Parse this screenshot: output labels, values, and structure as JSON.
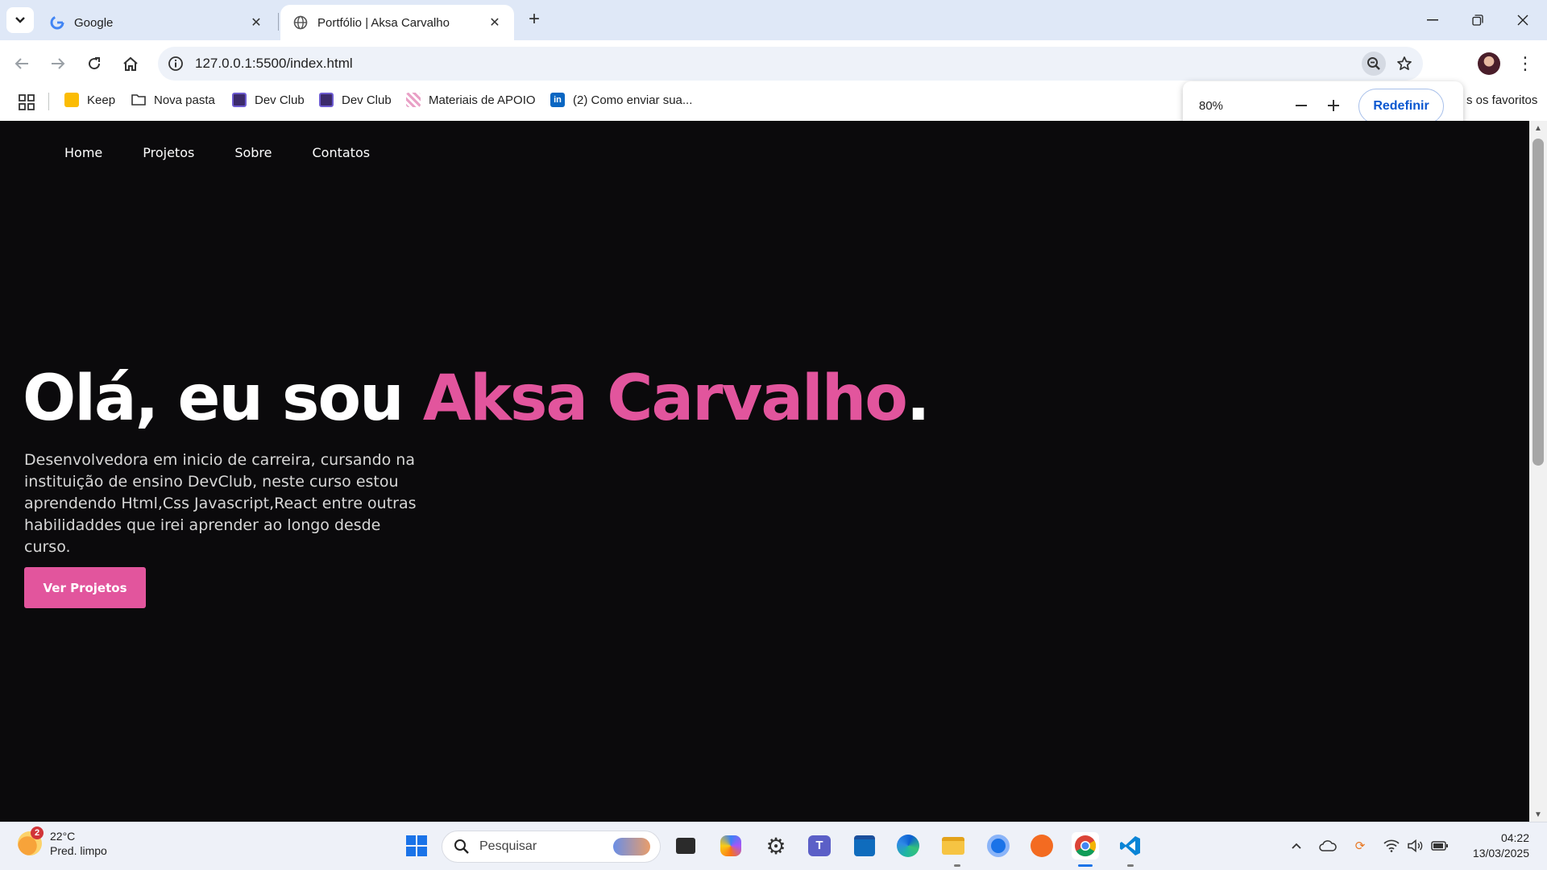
{
  "browser": {
    "tabs": [
      {
        "title": "Google",
        "active": false
      },
      {
        "title": "Portfólio | Aksa Carvalho",
        "active": true
      }
    ],
    "url": "127.0.0.1:5500/index.html",
    "bookmarks": [
      {
        "label": "Keep",
        "icon": "keep-icon"
      },
      {
        "label": "Nova pasta",
        "icon": "folder-icon"
      },
      {
        "label": "Dev Club",
        "icon": "devclub-icon"
      },
      {
        "label": "Dev Club",
        "icon": "devclub-icon"
      },
      {
        "label": "Materiais de APOIO",
        "icon": "bookmark-icon"
      },
      {
        "label": "(2) Como enviar sua...",
        "icon": "linkedin-icon"
      }
    ],
    "bookmarks_right": "s os favoritos",
    "zoom": {
      "level": "80%",
      "reset_label": "Redefinir"
    }
  },
  "page": {
    "nav": [
      "Home",
      "Projetos",
      "Sobre",
      "Contatos"
    ],
    "hero": {
      "title_prefix": "Olá, eu sou ",
      "title_name": "Aksa Carvalho",
      "title_suffix": ".",
      "description": "Desenvolvedora em inicio de carreira, cursando na instituição de ensino DevClub, neste curso estou aprendendo Html,Css Javascript,React entre outras habilidaddes que irei aprender ao longo desde curso.",
      "cta_label": "Ver Projetos"
    },
    "colors": {
      "accent": "#e2559d",
      "background": "#0b0a0c"
    }
  },
  "taskbar": {
    "weather": {
      "temp": "22°C",
      "condition": "Pred. limpo",
      "badge": "2"
    },
    "search_placeholder": "Pesquisar",
    "clock": {
      "time": "04:22",
      "date": "13/03/2025"
    }
  }
}
